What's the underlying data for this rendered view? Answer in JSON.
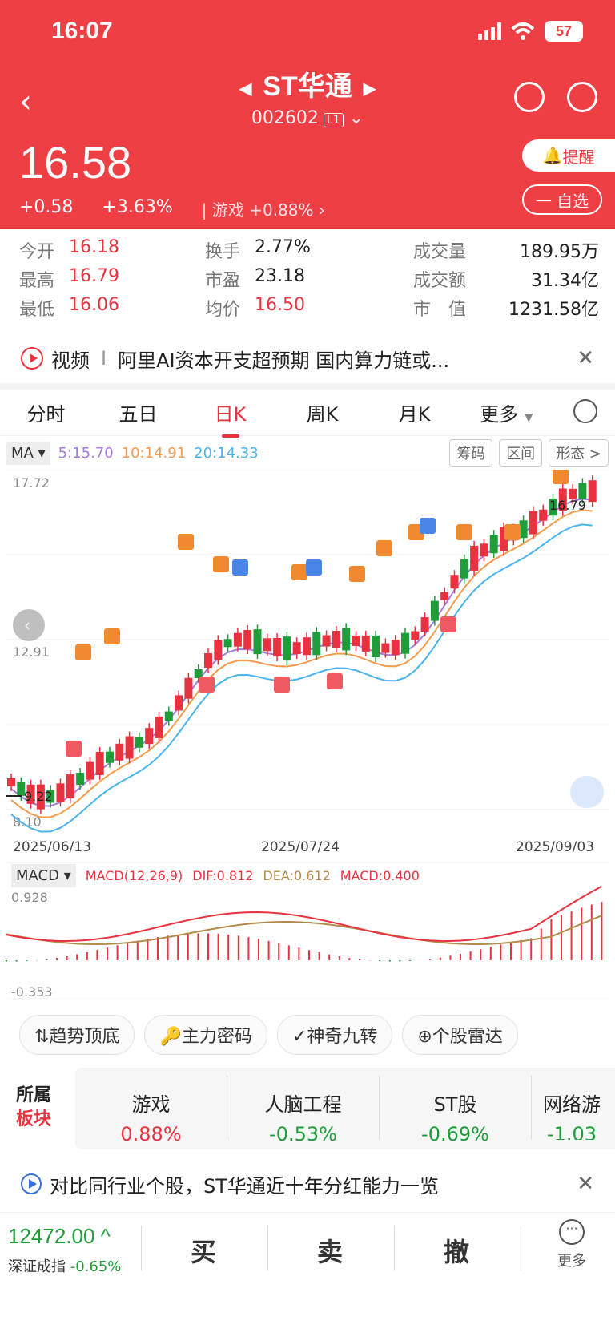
{
  "status": {
    "time": "16:07",
    "battery": "57"
  },
  "header": {
    "name": "ST华通",
    "code": "002602",
    "level": "L1",
    "price": "16.58",
    "change": "+0.58",
    "change_pct": "+3.63%",
    "sector": "游戏",
    "sector_pct": "+0.88%",
    "remind": "提醒",
    "fav": "一 自选"
  },
  "stats": {
    "open": {
      "label": "今开",
      "value": "16.18"
    },
    "high": {
      "label": "最高",
      "value": "16.79"
    },
    "low": {
      "label": "最低",
      "value": "16.06"
    },
    "turnover": {
      "label": "换手",
      "value": "2.77%"
    },
    "pe": {
      "label": "市盈",
      "value": "23.18"
    },
    "avg": {
      "label": "均价",
      "value": "16.50"
    },
    "volume": {
      "label": "成交量",
      "value": "189.95万"
    },
    "amount": {
      "label": "成交额",
      "value": "31.34亿"
    },
    "mktcap": {
      "label": "市　值",
      "value": "1231.58亿"
    }
  },
  "news": {
    "tag": "视频",
    "text": "阿里AI资本开支超预期  国内算力链或..."
  },
  "tabs": [
    "分时",
    "五日",
    "日K",
    "周K",
    "月K",
    "更多"
  ],
  "ma": {
    "label": "MA",
    "ma5": "5:15.70",
    "ma10": "10:14.91",
    "ma20": "20:14.33",
    "chips": [
      "筹码",
      "区间",
      "形态 >"
    ]
  },
  "chart": {
    "y_top": "17.72",
    "y_mid": "12.91",
    "y_bottom": "8.10",
    "hi_label": "16.79",
    "lo_label": "9.22",
    "dates": [
      "2025/06/13",
      "2025/07/24",
      "2025/09/03"
    ]
  },
  "macd": {
    "label": "MACD",
    "params": "MACD(12,26,9)",
    "dif": "DIF:0.812",
    "dea": "DEA:0.612",
    "macd": "MACD:0.400",
    "top": "0.928",
    "bottom": "-0.353"
  },
  "tools": [
    "趋势顶底",
    "主力密码",
    "神奇九转",
    "个股雷达"
  ],
  "sectors": {
    "title1": "所属",
    "title2": "板块",
    "items": [
      {
        "name": "游戏",
        "pct": "0.88%"
      },
      {
        "name": "人脑工程",
        "pct": "-0.53%"
      },
      {
        "name": "ST股",
        "pct": "-0.69%"
      },
      {
        "name": "网络游",
        "pct": "-1.03"
      }
    ]
  },
  "news2": {
    "text": "对比同行业个股，ST华通近十年分红能力一览"
  },
  "bottom": {
    "index_value": "12472.00",
    "index_name": "深证成指",
    "index_pct": "-0.65%",
    "buy": "买",
    "sell": "卖",
    "cancel": "撤",
    "more": "更多"
  },
  "colors": {
    "header": "#ee3f45",
    "up": "#e8323f",
    "down": "#1f9d3a",
    "ma5": "#a57be0",
    "ma10": "#f59a4a",
    "ma20": "#4ab3ee"
  }
}
